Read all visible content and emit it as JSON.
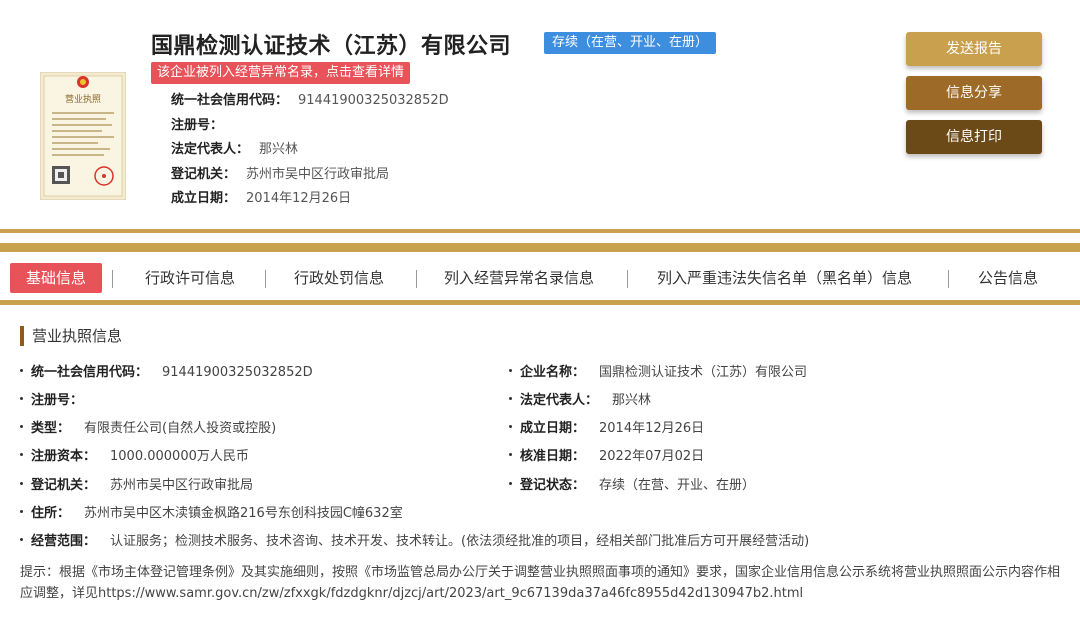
{
  "company": {
    "name": "国鼎检测认证技术（江苏）有限公司",
    "status": "存续（在营、开业、在册）",
    "abnormal_notice": "该企业被列入经营异常名录，点击查看详情"
  },
  "summary": [
    {
      "label": "统一社会信用代码：",
      "value": "91441900325032852D"
    },
    {
      "label": "注册号：",
      "value": ""
    },
    {
      "label": "法定代表人：",
      "value": "那兴林"
    },
    {
      "label": "登记机关：",
      "value": "苏州市吴中区行政审批局"
    },
    {
      "label": "成立日期：",
      "value": "2014年12月26日"
    }
  ],
  "buttons": {
    "send": "发送报告",
    "share": "信息分享",
    "print": "信息打印"
  },
  "tabs": [
    "基础信息",
    "行政许可信息",
    "行政处罚信息",
    "列入经营异常名录信息",
    "列入严重违法失信名单（黑名单）信息",
    "公告信息"
  ],
  "section": {
    "title": "营业执照信息"
  },
  "fields": {
    "credit_code": {
      "label": "统一社会信用代码：",
      "value": "91441900325032852D"
    },
    "company_name": {
      "label": "企业名称：",
      "value": "国鼎检测认证技术（江苏）有限公司"
    },
    "reg_no": {
      "label": "注册号：",
      "value": ""
    },
    "legal_rep": {
      "label": "法定代表人：",
      "value": "那兴林"
    },
    "type": {
      "label": "类型：",
      "value": "有限责任公司(自然人投资或控股)"
    },
    "established": {
      "label": "成立日期：",
      "value": "2014年12月26日"
    },
    "capital": {
      "label": "注册资本：",
      "value": "1000.000000万人民币"
    },
    "approved": {
      "label": "核准日期：",
      "value": "2022年07月02日"
    },
    "authority": {
      "label": "登记机关：",
      "value": "苏州市吴中区行政审批局"
    },
    "reg_status": {
      "label": "登记状态：",
      "value": "存续（在营、开业、在册）"
    },
    "address": {
      "label": "住所：",
      "value": "苏州市吴中区木渎镇金枫路216号东创科技园C幢632室"
    },
    "scope": {
      "label": "经营范围：",
      "value": "认证服务；检测技术服务、技术咨询、技术开发、技术转让。(依法须经批准的项目，经相关部门批准后方可开展经营活动)"
    }
  },
  "note": "提示：根据《市场主体登记管理条例》及其实施细则，按照《市场监管总局办公厅关于调整营业执照照面事项的通知》要求，国家企业信用信息公示系统将营业执照照面公示内容作相应调整，详见https://www.samr.gov.cn/zw/zfxxgk/fdzdgknr/djzcj/art/2023/art_9c67139da37a46fc8955d42d130947b2.html",
  "license_image": {
    "heading": "营业执照"
  },
  "colors": {
    "gold": "#c9a04e",
    "brown": "#9e6a27",
    "dark_brown": "#6b4a17",
    "red": "#e8535a",
    "blue": "#3e8ee0"
  }
}
